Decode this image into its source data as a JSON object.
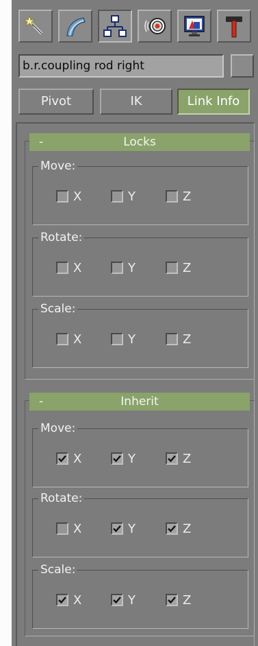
{
  "tabs": [
    {
      "icon": "create-icon",
      "active": false
    },
    {
      "icon": "modify-icon",
      "active": false
    },
    {
      "icon": "hierarchy-icon",
      "active": true
    },
    {
      "icon": "motion-icon",
      "active": false
    },
    {
      "icon": "display-icon",
      "active": false
    },
    {
      "icon": "utilities-icon",
      "active": false
    }
  ],
  "object": {
    "name": "b.r.coupling rod right"
  },
  "mode_buttons": {
    "pivot": "Pivot",
    "ik": "IK",
    "link_info": "Link Info"
  },
  "active_mode": "link_info",
  "locks": {
    "collapse": "-",
    "title": "Locks",
    "move": {
      "label": "Move:",
      "x": "X",
      "y": "Y",
      "z": "Z",
      "checked": [
        false,
        false,
        false
      ]
    },
    "rotate": {
      "label": "Rotate:",
      "x": "X",
      "y": "Y",
      "z": "Z",
      "checked": [
        false,
        false,
        false
      ]
    },
    "scale": {
      "label": "Scale:",
      "x": "X",
      "y": "Y",
      "z": "Z",
      "checked": [
        false,
        false,
        false
      ]
    }
  },
  "inherit": {
    "collapse": "-",
    "title": "Inherit",
    "move": {
      "label": "Move:",
      "x": "X",
      "y": "Y",
      "z": "Z",
      "checked": [
        true,
        true,
        true
      ]
    },
    "rotate": {
      "label": "Rotate:",
      "x": "X",
      "y": "Y",
      "z": "Z",
      "checked": [
        false,
        true,
        true
      ]
    },
    "scale": {
      "label": "Scale:",
      "x": "X",
      "y": "Y",
      "z": "Z",
      "checked": [
        true,
        true,
        true
      ]
    }
  },
  "colors": {
    "accent_green": "#8aa36a",
    "panel_gray": "#7c7c7c"
  }
}
